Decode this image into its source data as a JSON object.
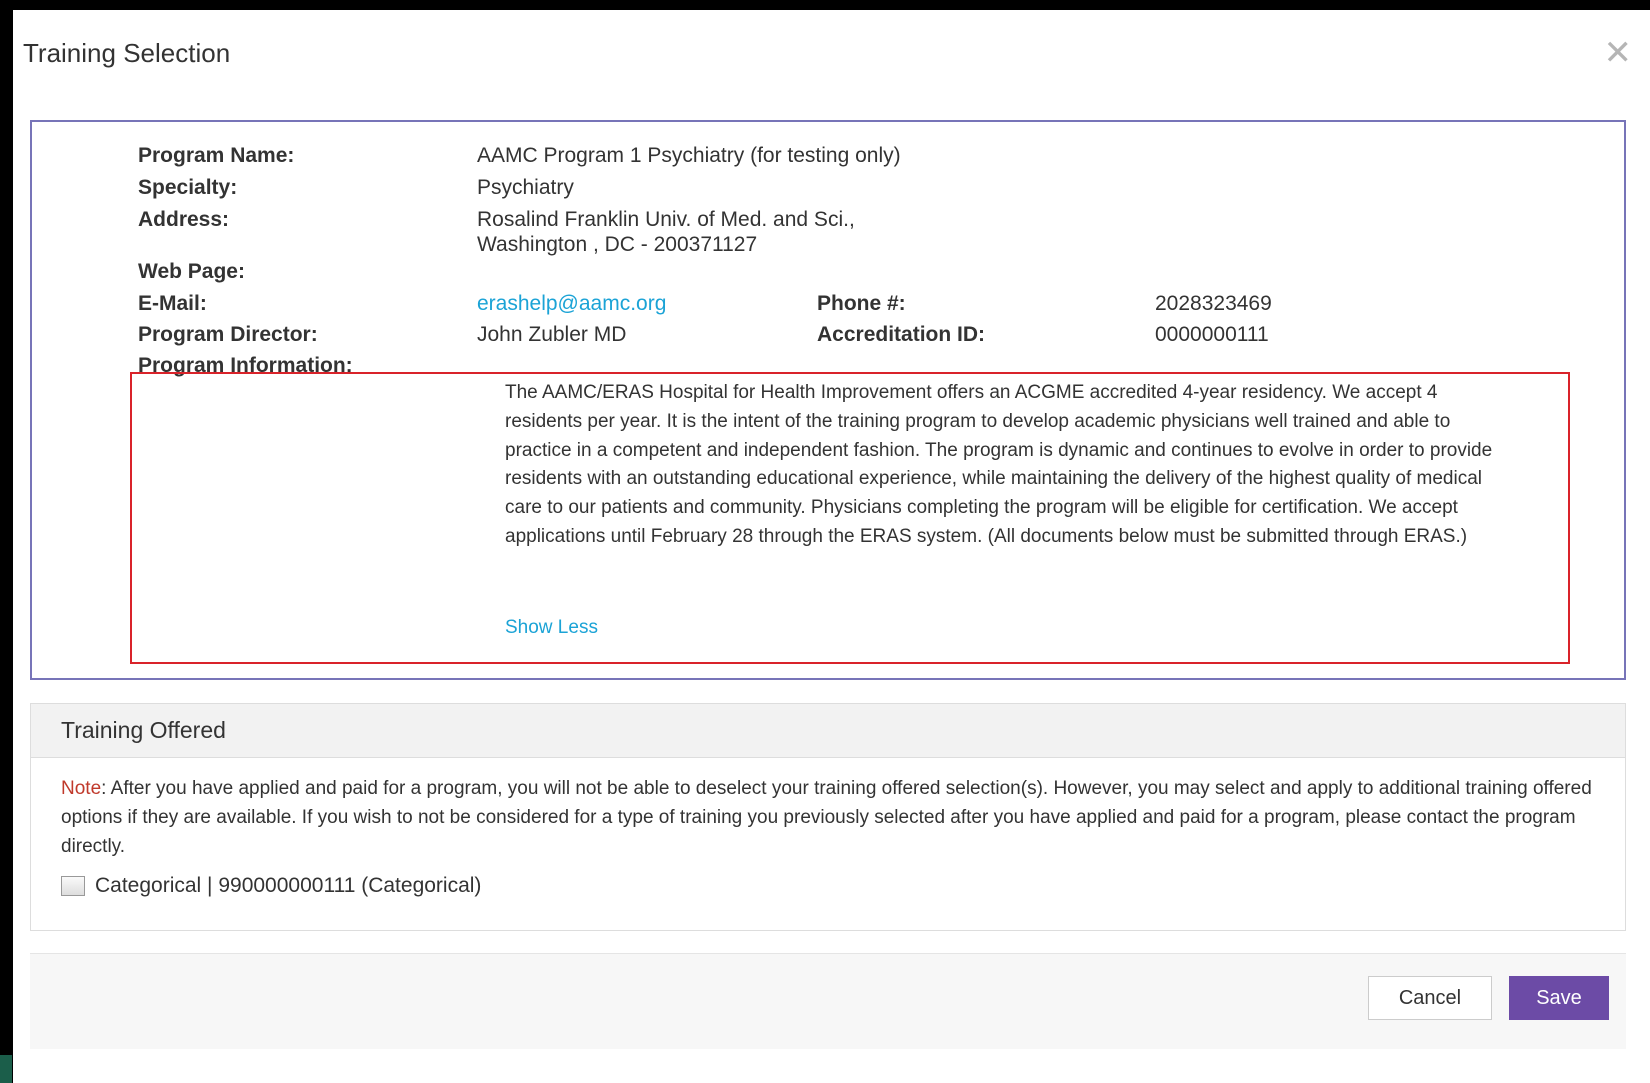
{
  "dialog": {
    "title": "Training Selection",
    "close_icon": "close-icon"
  },
  "program": {
    "name_label": "Program Name:",
    "name": "AAMC Program 1 Psychiatry (for testing only)",
    "specialty_label": "Specialty:",
    "specialty": "Psychiatry",
    "address_label": "Address:",
    "address_line1": "Rosalind Franklin Univ. of Med. and Sci.,",
    "address_line2": "Washington , DC - 200371127",
    "webpage_label": "Web Page:",
    "webpage": "",
    "email_label": "E-Mail:",
    "email": "erashelp@aamc.org",
    "phone_label": "Phone #:",
    "phone": "2028323469",
    "director_label": "Program Director:",
    "director": "John Zubler MD",
    "accreditation_label": "Accreditation ID:",
    "accreditation_id": "0000000111",
    "info_label": "Program Information:",
    "info_text": "The AAMC/ERAS Hospital for Health Improvement offers an ACGME accredited 4-year residency. We accept 4 residents per year. It is the intent of the training program to develop academic physicians well trained and able to practice in a competent and independent fashion. The program is dynamic and continues to evolve in order to provide residents with an outstanding educational experience, while maintaining the delivery of the highest quality of medical care to our patients and community. Physicians completing the program will be eligible for certification. We accept applications until February 28 through the ERAS system. (All documents below must be submitted through ERAS.)",
    "show_less": "Show Less"
  },
  "training_offered": {
    "header": "Training Offered",
    "note_label": "Note",
    "note_text": ": After you have applied and paid for a program, you will not be able to deselect your training offered selection(s). However, you may select and apply to additional training offered options if they are available. If you wish to not be considered for a type of training you previously selected after you have applied and paid for a program, please contact the program directly.",
    "option_label": "Categorical | 990000000111 (Categorical)",
    "option_checked": false
  },
  "footer": {
    "cancel_label": "Cancel",
    "save_label": "Save"
  },
  "colors": {
    "accent": "#6c4ba6",
    "link": "#1ba3d6",
    "highlight_border": "#d9232a",
    "box_border": "#7774b8"
  }
}
